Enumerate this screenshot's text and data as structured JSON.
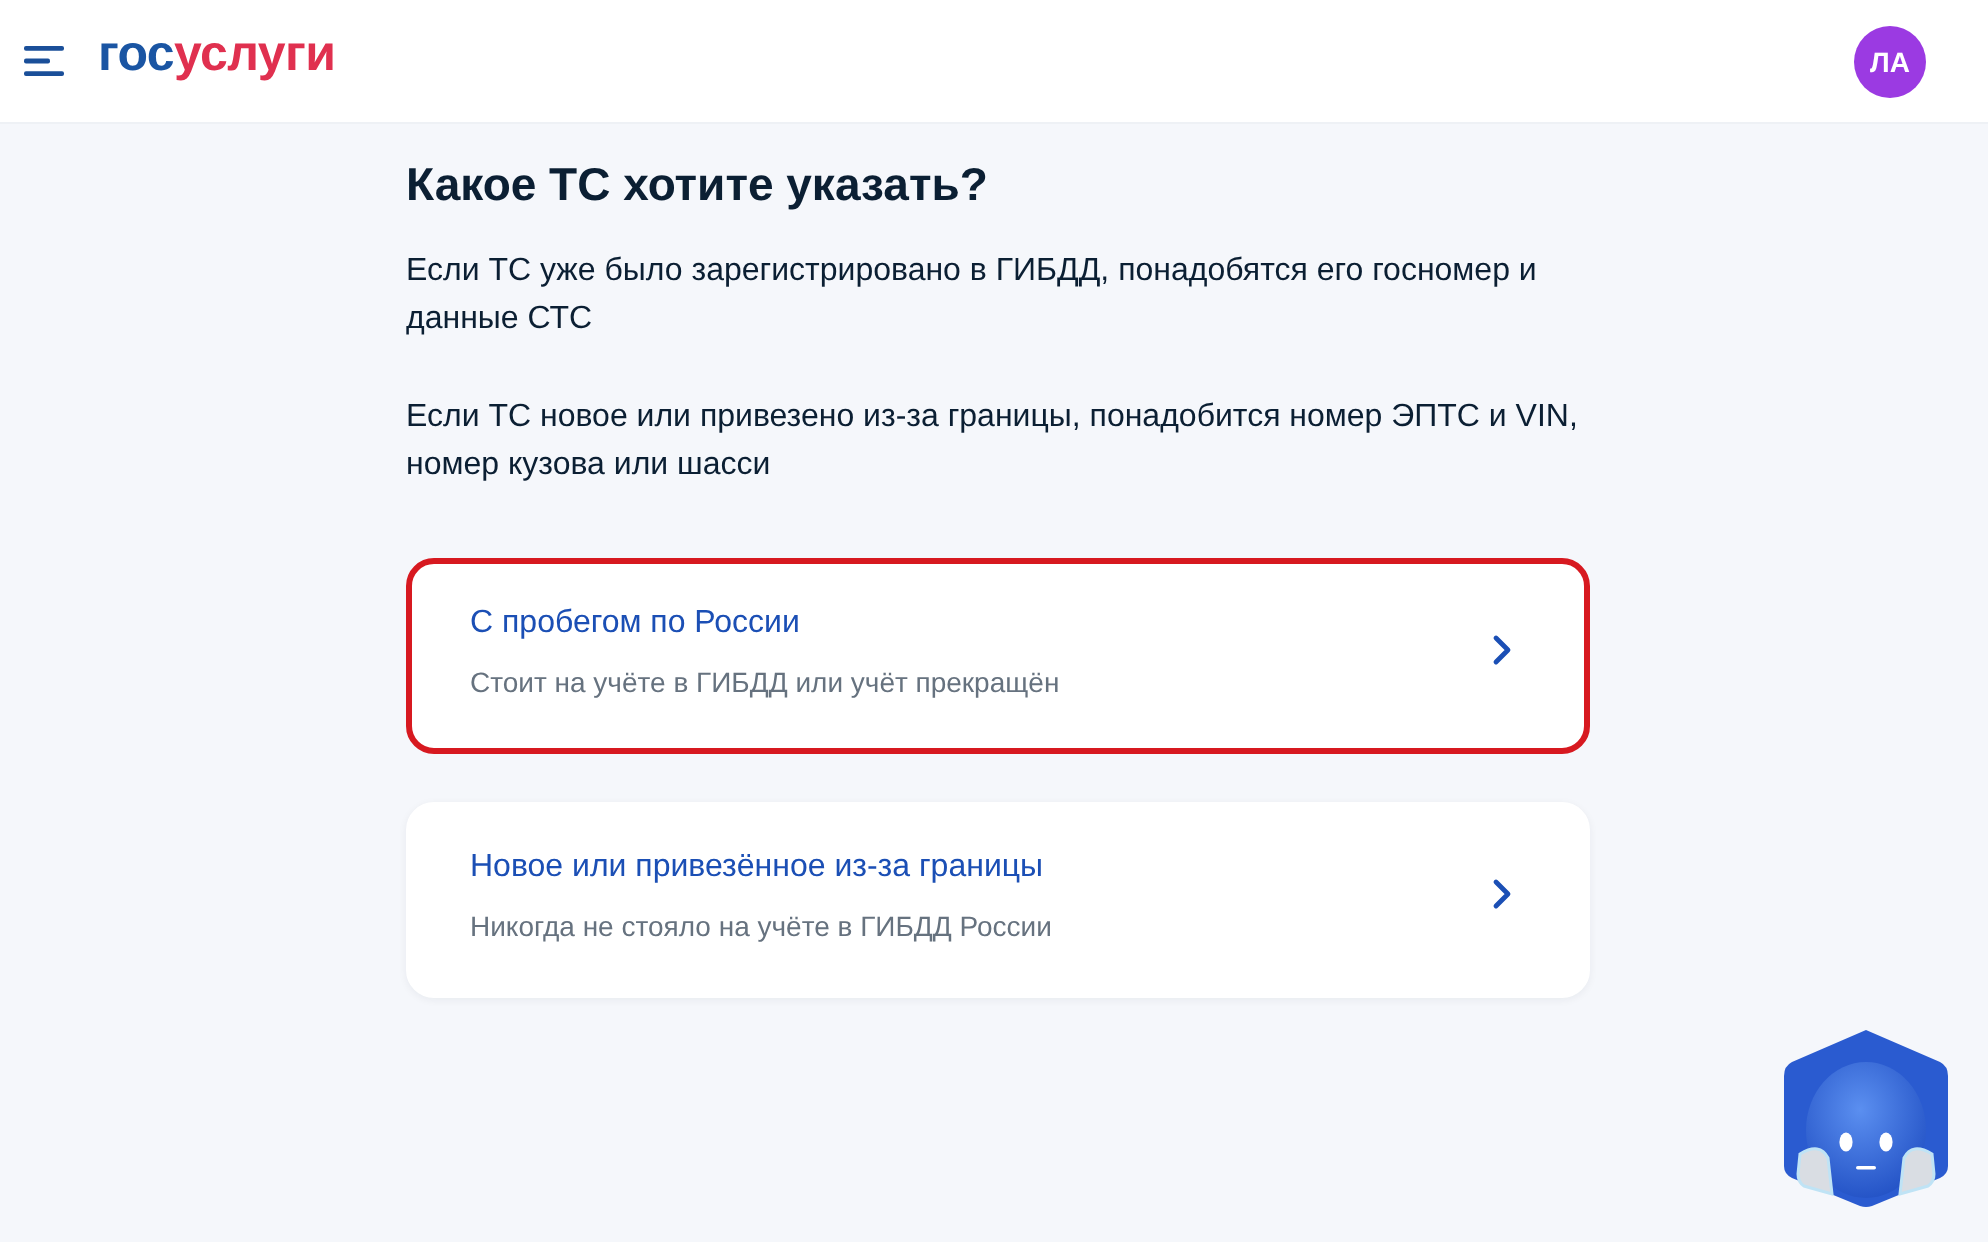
{
  "header": {
    "logo": [
      "гос",
      "услуги"
    ],
    "avatar": {
      "initials": "ЛА"
    }
  },
  "page": {
    "title": "Какое ТС хотите указать?",
    "paragraphs": [
      "Если ТС уже было зарегистрировано в ГИБДД, понадобятся его госномер и данные СТС",
      "Если ТС новое или привезено из-за границы, понадобится номер ЭПТС и VIN, номер кузова или шасси"
    ]
  },
  "options": [
    {
      "title": "С пробегом по России",
      "subtitle": "Стоит на учёте в ГИБДД или учёт прекращён",
      "highlighted": true
    },
    {
      "title": "Новое или привезённое из-за границы",
      "subtitle": "Никогда не стояло на учёте в ГИБДД России",
      "highlighted": false
    }
  ]
}
